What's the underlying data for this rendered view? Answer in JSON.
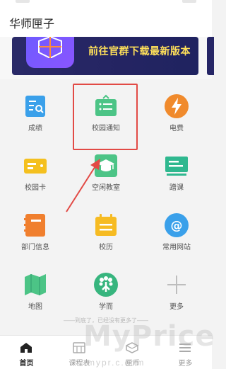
{
  "app": {
    "title": "华师匣子"
  },
  "banner": {
    "text": "前往官群下载最新版本"
  },
  "grid": {
    "items": [
      {
        "label": "成绩",
        "icon": "grades-icon",
        "color": "#3aa0ea"
      },
      {
        "label": "校园通知",
        "icon": "campus-notice-icon",
        "color": "#4cc486"
      },
      {
        "label": "电费",
        "icon": "electricity-icon",
        "color": "#f08a2c"
      },
      {
        "label": "校园卡",
        "icon": "campus-card-icon",
        "color": "#f4c01f"
      },
      {
        "label": "空闲教室",
        "icon": "free-classroom-icon",
        "color": "#4cc486"
      },
      {
        "label": "蹭课",
        "icon": "audit-class-icon",
        "color": "#2fb88f"
      },
      {
        "label": "部门信息",
        "icon": "department-info-icon",
        "color": "#f07f2e"
      },
      {
        "label": "校历",
        "icon": "calendar-icon",
        "color": "#f6bb22"
      },
      {
        "label": "常用网站",
        "icon": "website-icon",
        "color": "#3aa0ea"
      },
      {
        "label": "地图",
        "icon": "map-icon",
        "color": "#4cc486"
      },
      {
        "label": "学而",
        "icon": "xueer-icon",
        "color": "#37b57e"
      },
      {
        "label": "更多",
        "icon": "more-plus-icon",
        "color": "#bdbdbd"
      }
    ]
  },
  "hint": {
    "text": "——到底了，已经没有更多了——"
  },
  "tabs": [
    {
      "label": "首页",
      "icon": "home-icon",
      "active": true
    },
    {
      "label": "课程表",
      "icon": "timetable-icon",
      "active": false
    },
    {
      "label": "匣币",
      "icon": "coin-icon",
      "active": false
    },
    {
      "label": "更多",
      "icon": "more-icon",
      "active": false
    }
  ],
  "watermark": {
    "text": "MyPrice",
    "subtext": "mypr.c.com"
  }
}
